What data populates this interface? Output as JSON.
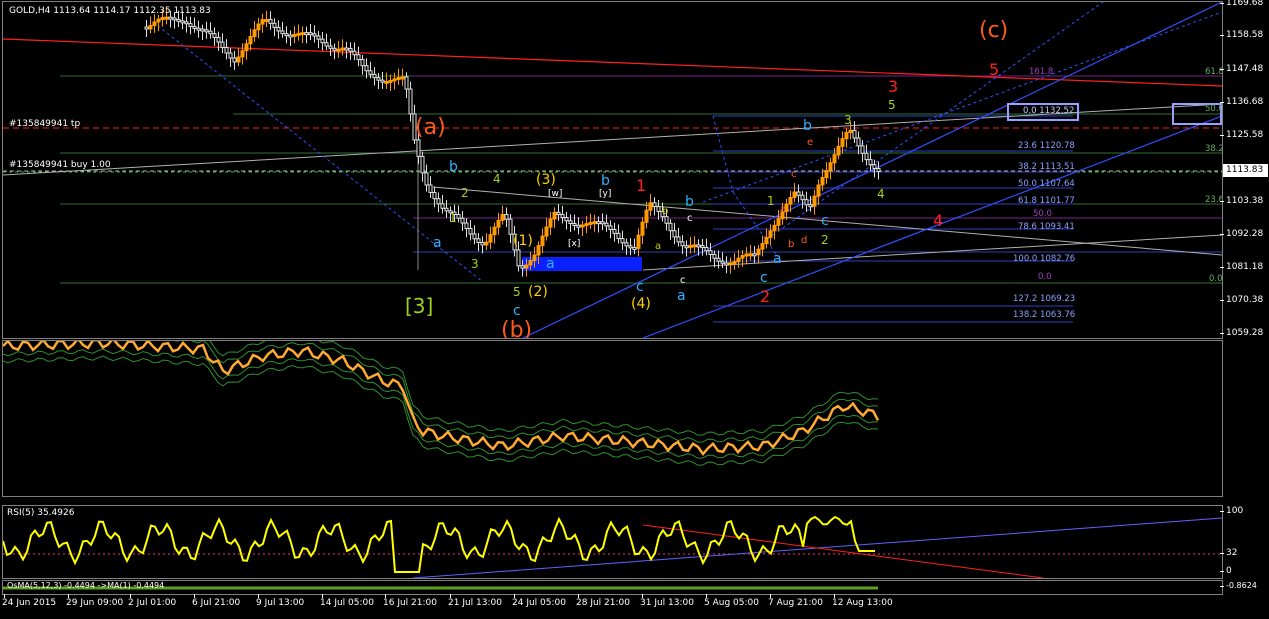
{
  "header": {
    "title": "GOLD,H4  1113.64 1114.17 1112.35 1113.83"
  },
  "orders": {
    "tp": "#135849941 tp",
    "buy": "#135849941 buy 1.00"
  },
  "price_axis": [
    "1169.68",
    "1158.58",
    "1147.48",
    "1136.68",
    "1125.58",
    "1113.83",
    "1103.38",
    "1092.28",
    "1081.18",
    "1070.38",
    "1059.28"
  ],
  "current_price": "1113.83",
  "rsi": {
    "title": "RSI(5) 35.4926",
    "ticks": [
      "100",
      "32",
      "0"
    ]
  },
  "osma": {
    "title": "OsMA(5,12,3) -0.4494 ->MA(1) -0.4494",
    "tick": "-0.8624"
  },
  "time_axis": [
    "24 Jun 2015",
    "29 Jun 09:00",
    "2 Jul 01:00",
    "6 Jul 21:00",
    "9 Jul 13:00",
    "14 Jul 05:00",
    "16 Jul 21:00",
    "21 Jul 13:00",
    "24 Jul 05:00",
    "28 Jul 21:00",
    "31 Jul 13:00",
    "5 Aug 05:00",
    "7 Aug 21:00",
    "12 Aug 13:00"
  ],
  "fib_labels": [
    "0.0 1132.52",
    "23.6 1120.78",
    "38.2 1113.51",
    "50.0 1107.64",
    "61.8 1101.77",
    "78.6 1093.41",
    "100.0 1082.76",
    "127.2 1069.23",
    "138.2 1063.76"
  ],
  "fib_right": [
    "61.8",
    "50.0",
    "38.2",
    "23.6",
    "0.0",
    "161.8",
    "50.0",
    "0.0"
  ],
  "wave_labels": {
    "big_a": "(a)",
    "big_b": "(b)",
    "big_c": "(c)",
    "three_bracket": "[3]",
    "w": "[w]",
    "x": "[x]",
    "y": "[y]",
    "p3": "(3)",
    "p4": "(4)",
    "p2": "(2)",
    "p1": "(1)",
    "red1": "1",
    "red2": "2",
    "red3": "3",
    "red4": "4",
    "red5": "5",
    "g3": "3",
    "g4": "4",
    "g5": "5",
    "g2": "2",
    "g1": "1",
    "a": "a",
    "b": "b",
    "c": "c",
    "d": "d",
    "e": "e"
  },
  "colors": {
    "bg": "#000000",
    "grid_line": "#808080",
    "candle_up": "#ff9900",
    "candle_down": "#e0e0e0",
    "rsi": "#ffff00",
    "red_line": "#ff2020",
    "blue_line": "#3050ff",
    "fib": "#8aa0ff"
  }
}
